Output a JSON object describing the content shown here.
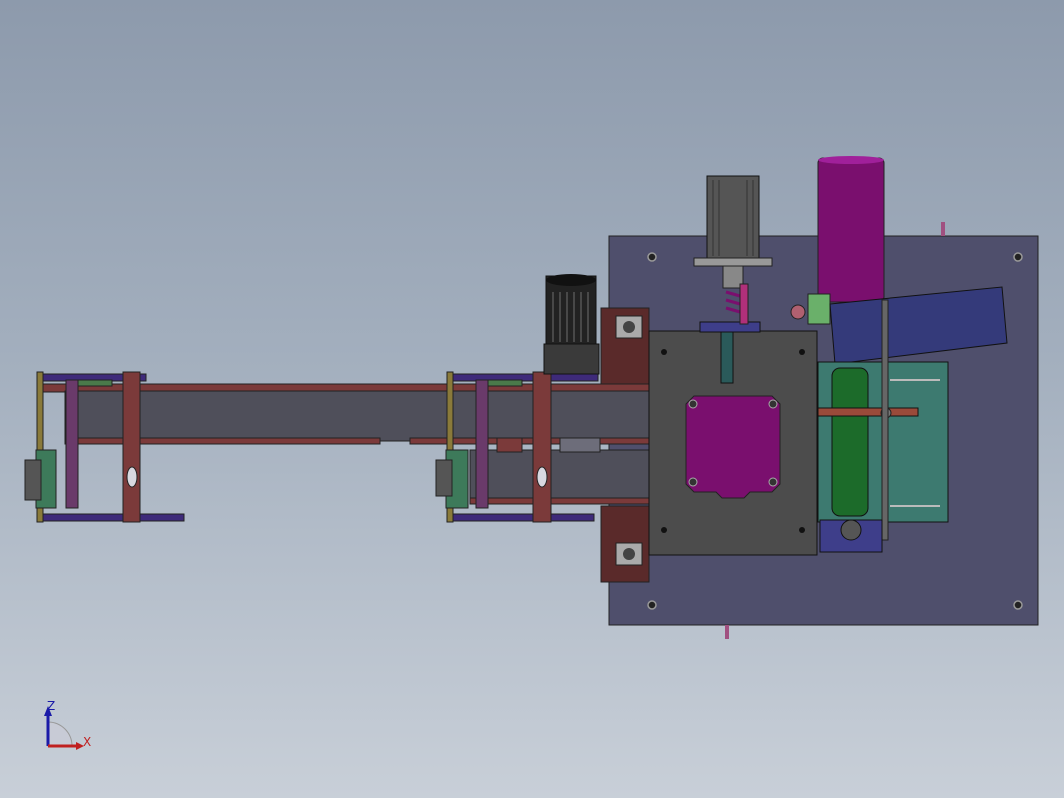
{
  "viewport": {
    "background_top": "#8d9aac",
    "background_bottom": "#c8cfd8"
  },
  "triad": {
    "z_label": "Z",
    "x_label": "X",
    "z_color": "#1a1aa8",
    "x_color": "#c02020"
  },
  "colors": {
    "base_plate": "#4f4f6c",
    "frame_rust": "#7b3a3a",
    "conveyor_dark": "#4f4f5a",
    "motor_magenta": "#7a0f6e",
    "housing_gray": "#4c4c4c",
    "teal_plate": "#3d7a70",
    "green_roller": "#1c6b2a",
    "navy_chute": "#343a7a"
  }
}
